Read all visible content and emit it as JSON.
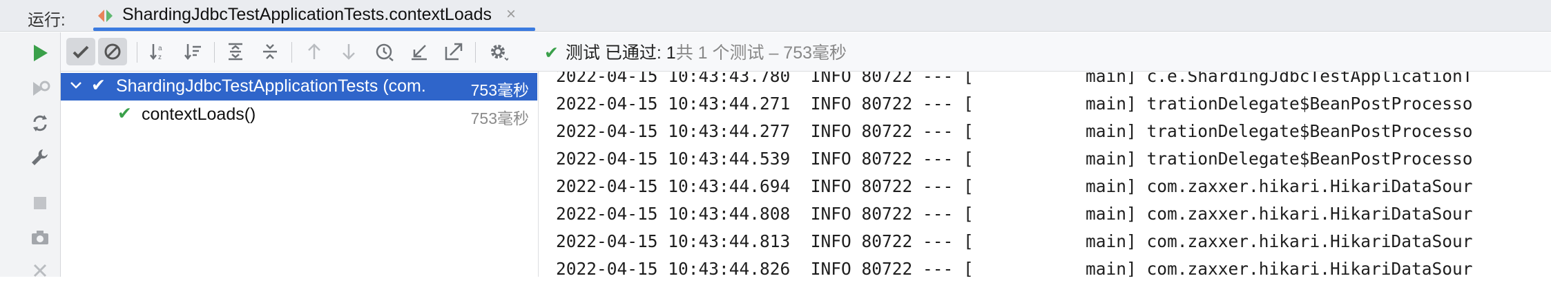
{
  "run_tab": {
    "run_label": "运行:",
    "config_name": "ShardingJdbcTestApplicationTests.contextLoads",
    "close_glyph": "×"
  },
  "toolbar": {
    "status_prefix": "测试 已通过: 1",
    "status_suffix": "共 1 个测试 – 753毫秒",
    "status_color": "#3aa04a"
  },
  "left_strip": {
    "icons": [
      "run-icon",
      "rerun-failed-icon",
      "toggle-auto-test-icon",
      "wrench-icon",
      "stop-icon",
      "camera-icon",
      "close-icon"
    ]
  },
  "test_tree": {
    "rows": [
      {
        "label": "ShardingJdbcTestApplicationTests (com.",
        "time": "753毫秒",
        "selected": true,
        "passed": true
      },
      {
        "label": "contextLoads()",
        "time": "753毫秒",
        "selected": false,
        "passed": true
      }
    ],
    "selection_color": "#2f65ca"
  },
  "console": {
    "lines": [
      "2022-04-15 10:43:43.780  INFO 80722 --- [           main] c.e.ShardingJdbcTestApplicationT",
      "2022-04-15 10:43:44.271  INFO 80722 --- [           main] trationDelegate$BeanPostProcesso",
      "2022-04-15 10:43:44.277  INFO 80722 --- [           main] trationDelegate$BeanPostProcesso",
      "2022-04-15 10:43:44.539  INFO 80722 --- [           main] trationDelegate$BeanPostProcesso",
      "2022-04-15 10:43:44.694  INFO 80722 --- [           main] com.zaxxer.hikari.HikariDataSour",
      "2022-04-15 10:43:44.808  INFO 80722 --- [           main] com.zaxxer.hikari.HikariDataSour",
      "2022-04-15 10:43:44.813  INFO 80722 --- [           main] com.zaxxer.hikari.HikariDataSour",
      "2022-04-15 10:43:44.826  INFO 80722 --- [           main] com.zaxxer.hikari.HikariDataSour"
    ]
  }
}
